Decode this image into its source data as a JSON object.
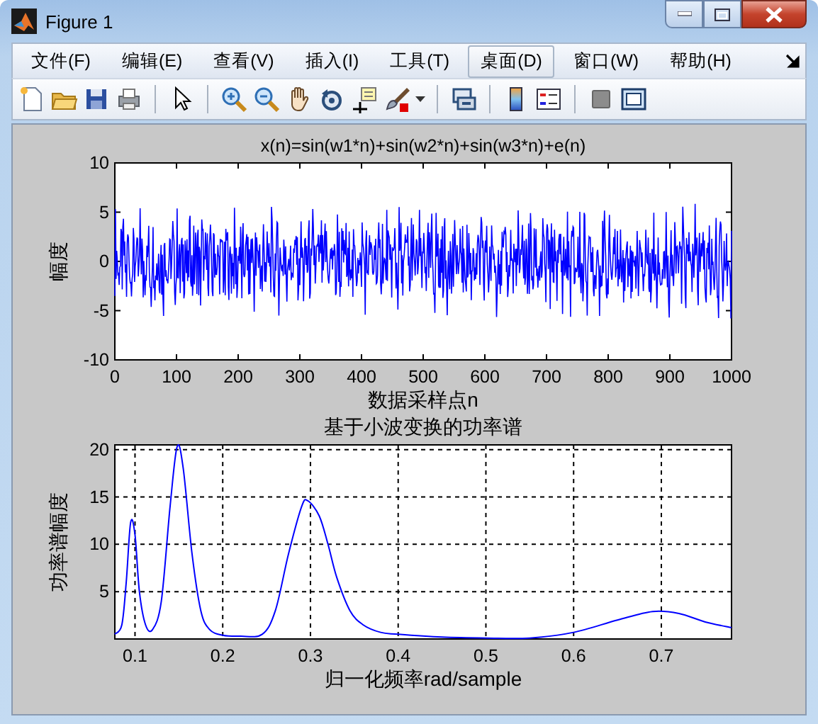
{
  "window": {
    "title": "Figure 1"
  },
  "menu": [
    {
      "label": "文件(F)",
      "selected": false
    },
    {
      "label": "编辑(E)",
      "selected": false
    },
    {
      "label": "查看(V)",
      "selected": false
    },
    {
      "label": "插入(I)",
      "selected": false
    },
    {
      "label": "工具(T)",
      "selected": false
    },
    {
      "label": "桌面(D)",
      "selected": true
    },
    {
      "label": "窗口(W)",
      "selected": false
    },
    {
      "label": "帮助(H)",
      "selected": false
    }
  ],
  "signal_plot": {
    "title": "x(n)=sin(w1*n)+sin(w2*n)+sin(w3*n)+e(n)",
    "xlabel": "数据采样点n",
    "ylabel": "幅度",
    "xticks": [
      "0",
      "100",
      "200",
      "300",
      "400",
      "500",
      "600",
      "700",
      "800",
      "900",
      "1000"
    ],
    "yticks": [
      "10",
      "5",
      "0",
      "-5",
      "-10"
    ]
  },
  "spectrum_plot": {
    "chart_data": {
      "type": "line",
      "title": "基于小波变换的功率谱",
      "xlabel": "归一化频率rad/sample",
      "ylabel": "功率谱幅度",
      "x": [
        0.077,
        0.085,
        0.09,
        0.095,
        0.1,
        0.105,
        0.112,
        0.12,
        0.13,
        0.14,
        0.148,
        0.155,
        0.165,
        0.175,
        0.185,
        0.2,
        0.22,
        0.245,
        0.26,
        0.275,
        0.29,
        0.297,
        0.31,
        0.32,
        0.33,
        0.345,
        0.36,
        0.38,
        0.4,
        0.45,
        0.5,
        0.55,
        0.6,
        0.65,
        0.69,
        0.72,
        0.75,
        0.78
      ],
      "series": [
        {
          "color": "#0000ff",
          "values": [
            0.5,
            1.5,
            6,
            12.3,
            11,
            5,
            1.5,
            1.0,
            4,
            14,
            20.3,
            18,
            9,
            3,
            1,
            0.4,
            0.3,
            0.5,
            3,
            9,
            14,
            14.6,
            13,
            10,
            6.5,
            3,
            1.5,
            0.7,
            0.5,
            0.2,
            0.1,
            0.1,
            0.7,
            2,
            2.9,
            2.7,
            1.8,
            1.2
          ]
        }
      ],
      "grid": true,
      "xlim": [
        0.077,
        0.78
      ],
      "ylim": [
        0,
        20.5
      ],
      "xticks": [
        0.1,
        0.2,
        0.3,
        0.4,
        0.5,
        0.6,
        0.7
      ],
      "yticks": [
        5,
        10,
        15,
        20
      ]
    }
  }
}
